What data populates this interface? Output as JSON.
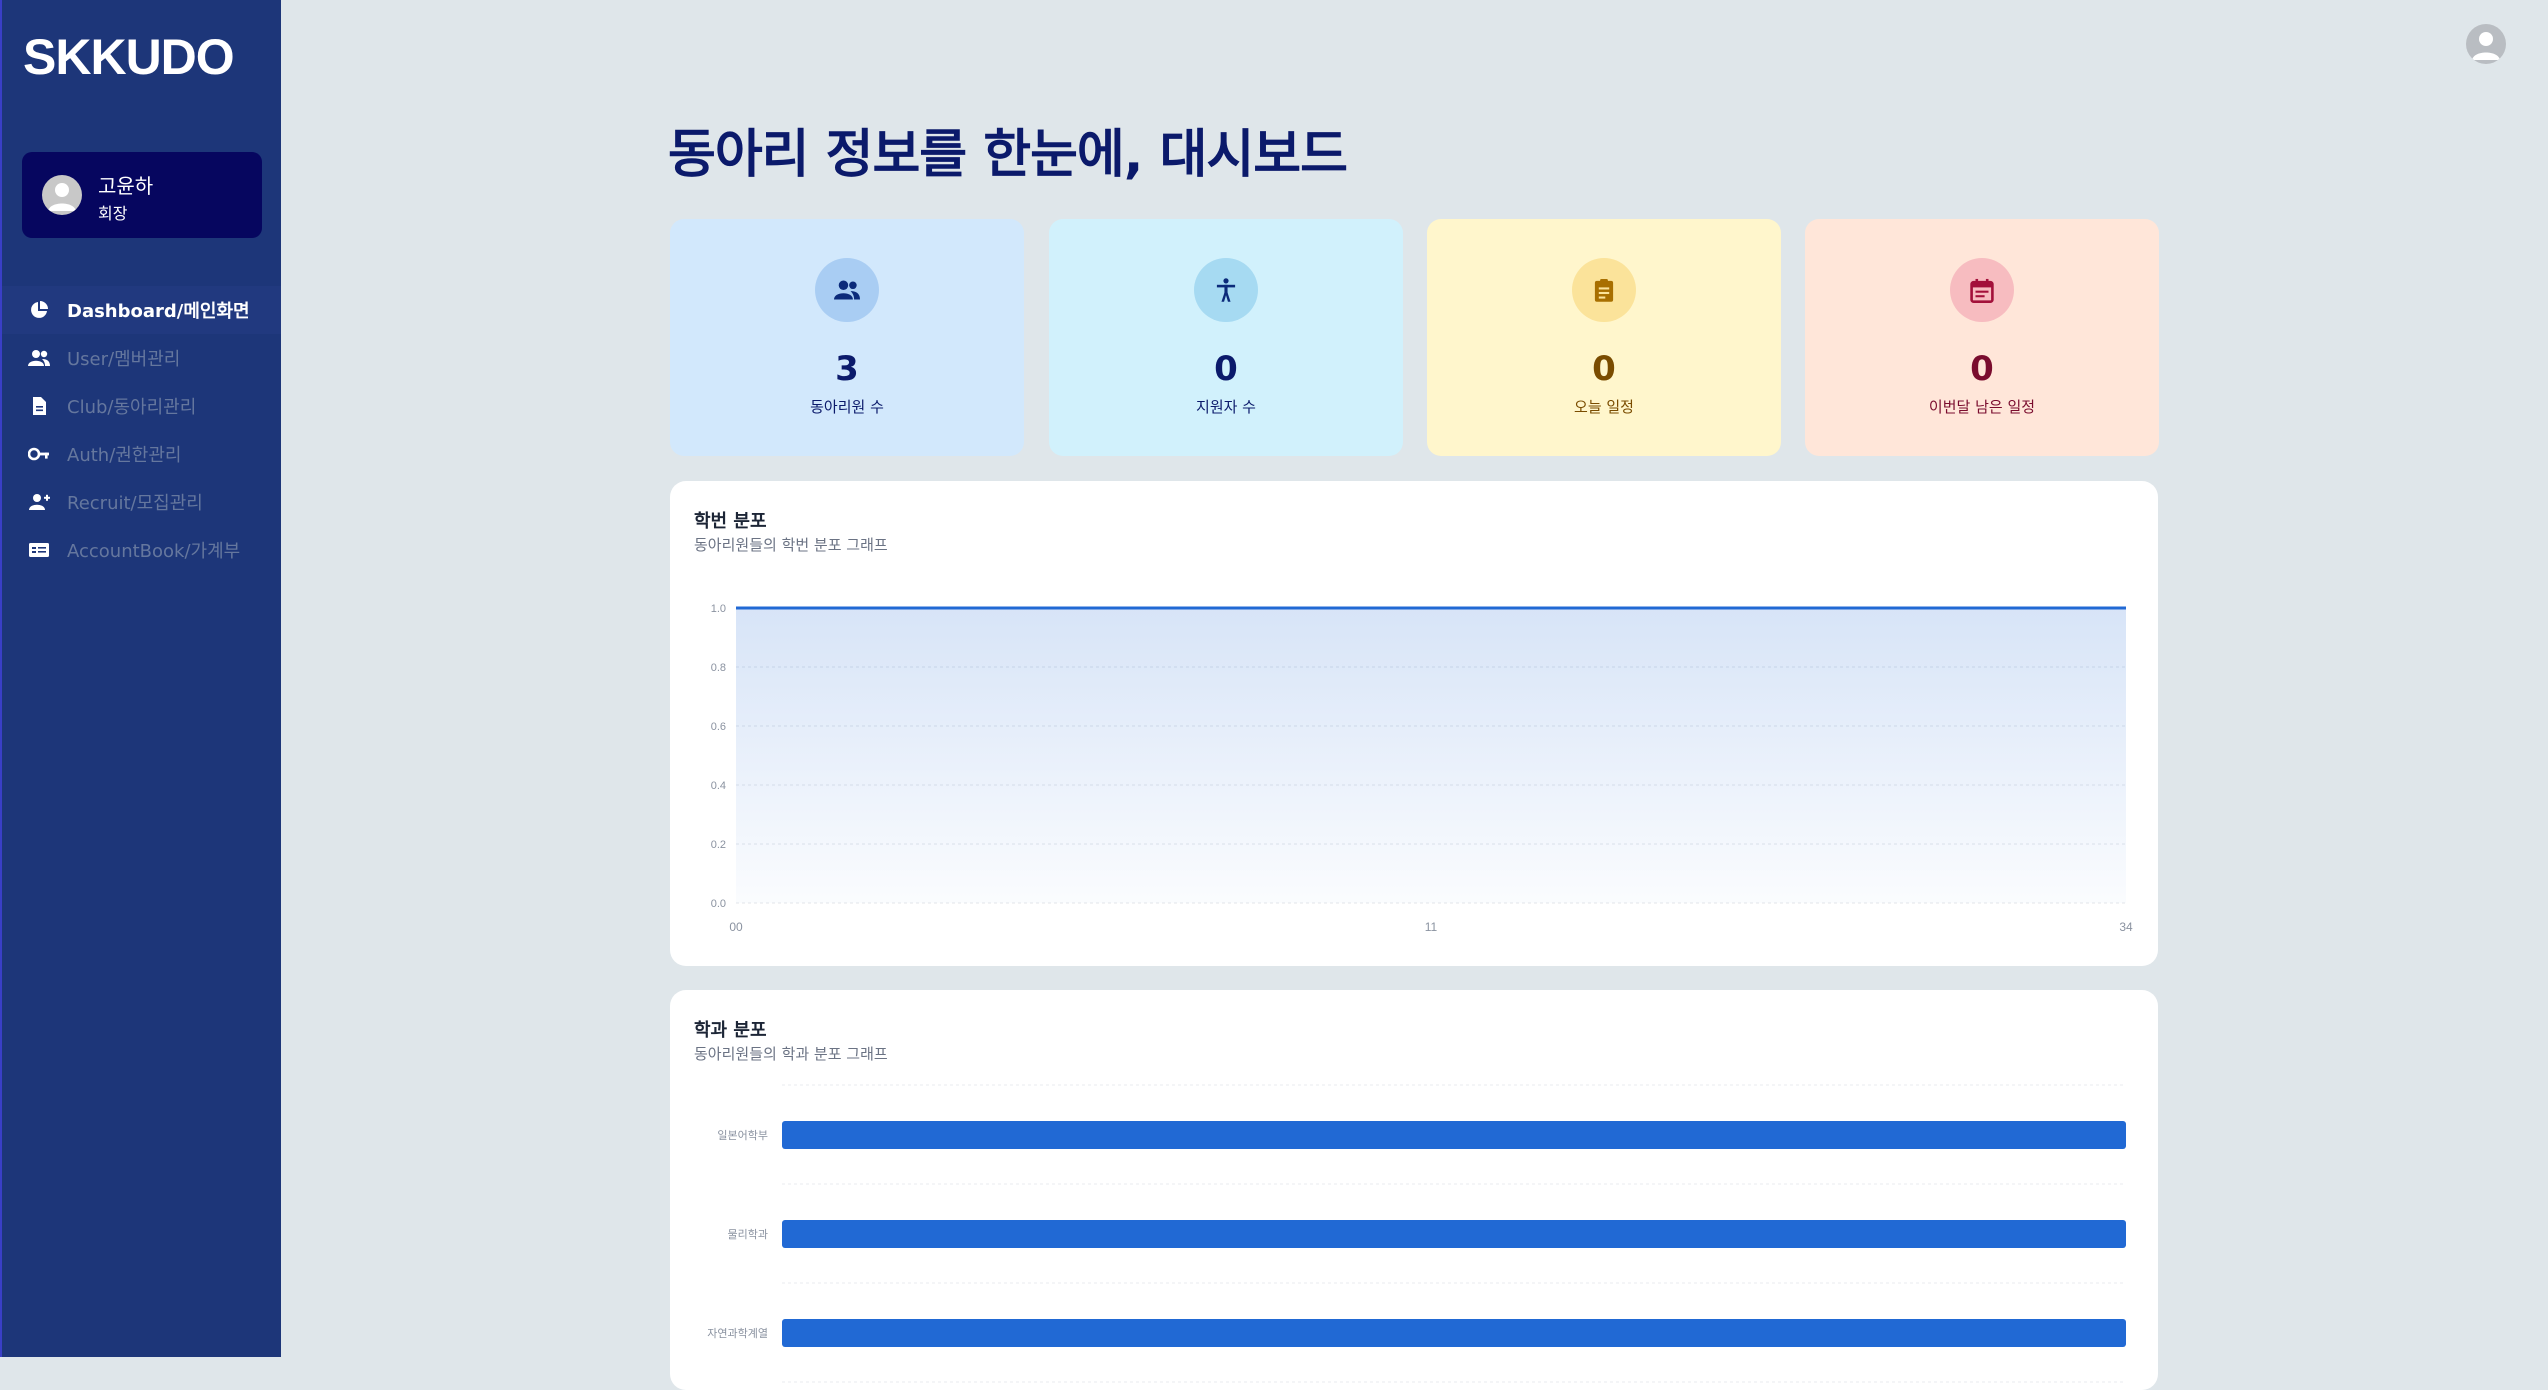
{
  "app": {
    "logo": "SKKUDO"
  },
  "user": {
    "name": "고윤하",
    "role": "회장"
  },
  "nav": [
    {
      "label": "Dashboard/메인화면",
      "icon": "pie-chart-icon",
      "active": true
    },
    {
      "label": "User/멤버관리",
      "icon": "people-icon",
      "active": false
    },
    {
      "label": "Club/동아리관리",
      "icon": "document-icon",
      "active": false
    },
    {
      "label": "Auth/권한관리",
      "icon": "key-icon",
      "active": false
    },
    {
      "label": "Recruit/모집관리",
      "icon": "person-add-icon",
      "active": false
    },
    {
      "label": "AccountBook/가계부",
      "icon": "id-card-icon",
      "active": false
    }
  ],
  "page": {
    "title": "동아리 정보를 한눈에, 대시보드"
  },
  "stats": [
    {
      "value": "3",
      "label": "동아리원 수",
      "icon": "people-icon",
      "bg": "#d2e8fc",
      "circle": "#a9cdf3",
      "text": "#0b1a6b"
    },
    {
      "value": "0",
      "label": "지원자 수",
      "icon": "accessibility-icon",
      "bg": "#d1f1fc",
      "circle": "#a6daf2",
      "text": "#0b1a6b"
    },
    {
      "value": "0",
      "label": "오늘 일정",
      "icon": "clipboard-icon",
      "bg": "#fff6cc",
      "circle": "#fbe39a",
      "text": "#7a4c00"
    },
    {
      "value": "0",
      "label": "이번달 남은 일정",
      "icon": "calendar-icon",
      "bg": "#ffe6d9",
      "circle": "#f7bcc0",
      "text": "#7a0c2e"
    }
  ],
  "panels": {
    "year": {
      "title": "학번 분포",
      "subtitle": "동아리원들의 학번 분포 그래프"
    },
    "dept": {
      "title": "학과 분포",
      "subtitle": "동아리원들의 학과 분포 그래프"
    }
  },
  "chart_data": [
    {
      "type": "area",
      "title": "학번 분포",
      "subtitle": "동아리원들의 학번 분포 그래프",
      "x": [
        "00",
        "11",
        "34"
      ],
      "series": [
        {
          "values": [
            1,
            1,
            1
          ]
        }
      ],
      "ylim": [
        0,
        1
      ],
      "yticks": [
        "0.0",
        "0.2",
        "0.4",
        "0.6",
        "0.8",
        "1.0"
      ],
      "grid": true,
      "color": "#2169d4"
    },
    {
      "type": "bar",
      "orientation": "horizontal",
      "title": "학과 분포",
      "subtitle": "동아리원들의 학과 분포 그래프",
      "categories": [
        "일본어학부",
        "물리학과",
        "자연과학계열"
      ],
      "values": [
        1,
        1,
        1
      ],
      "grid": true,
      "color": "#2169d4"
    }
  ]
}
